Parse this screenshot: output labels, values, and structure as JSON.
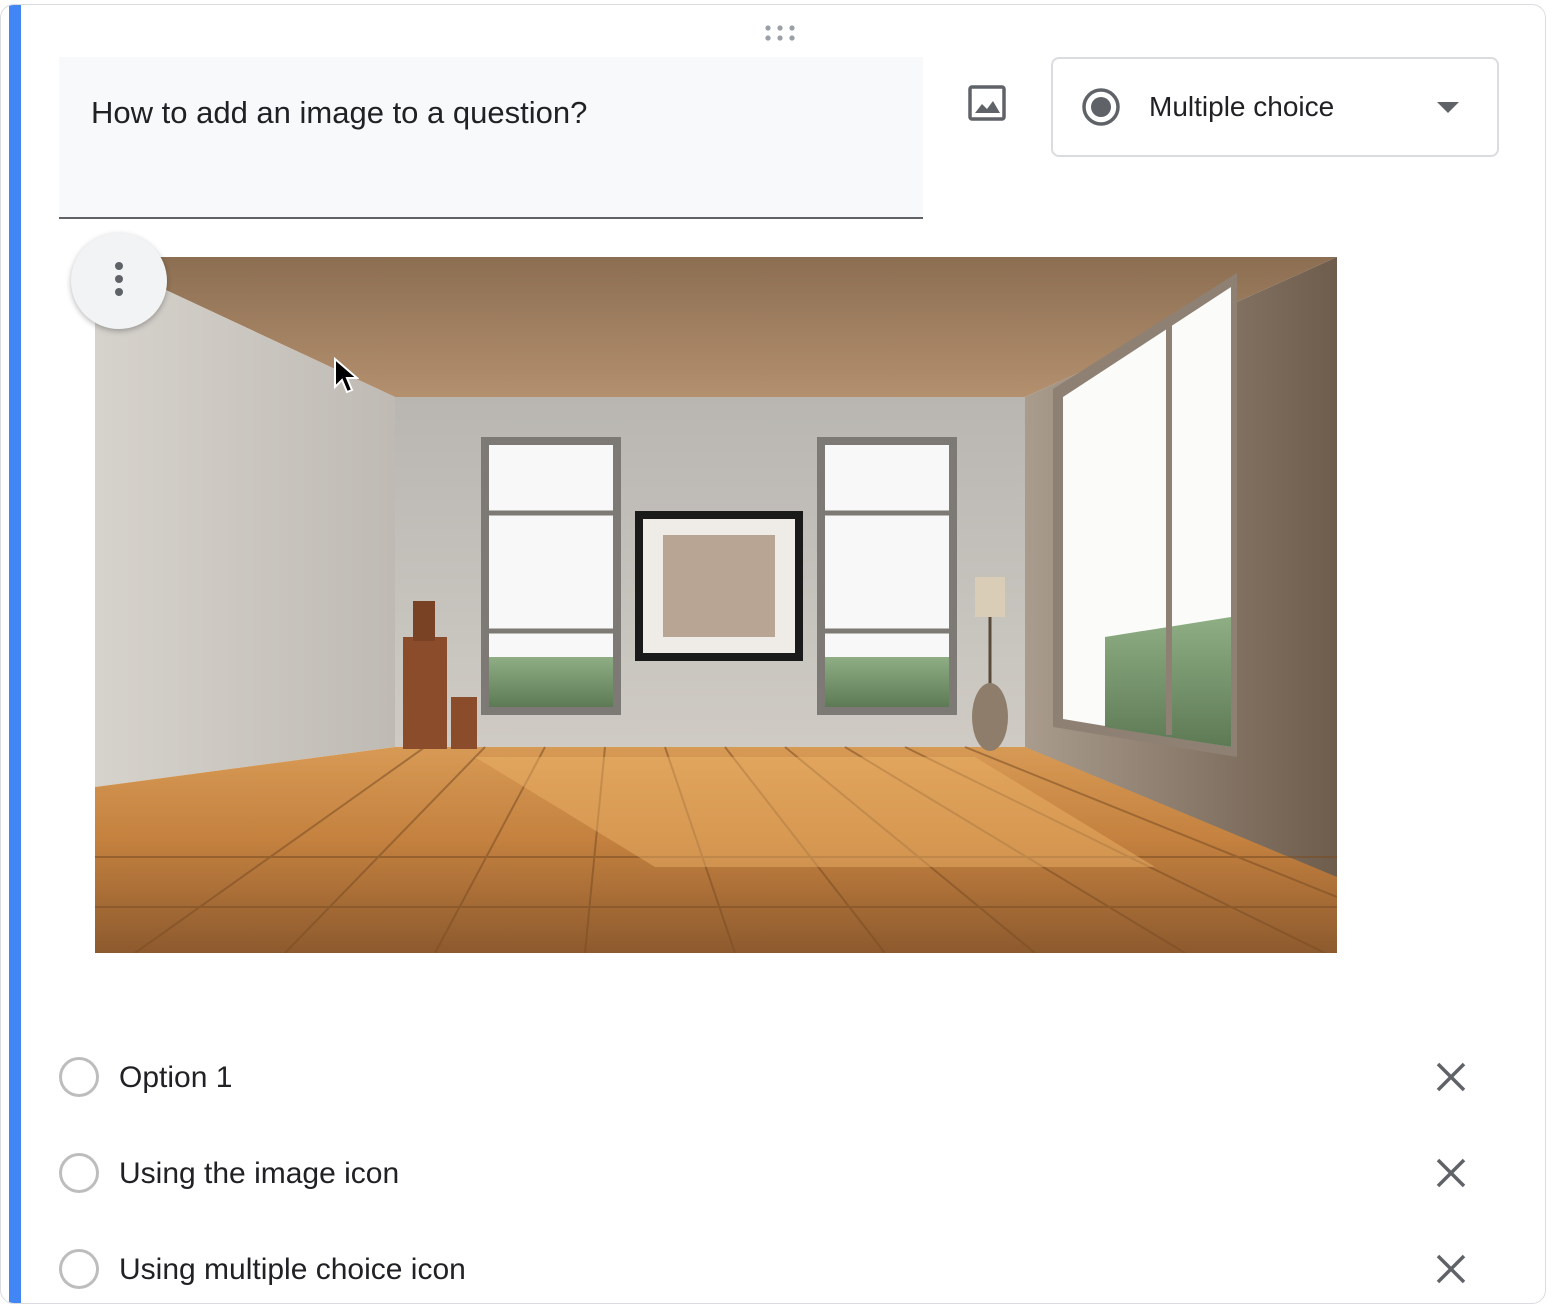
{
  "question": {
    "title": "How to add an image to a question?"
  },
  "toolbar": {
    "add_image_icon": "image-icon"
  },
  "question_type": {
    "selected": "Multiple choice",
    "icon": "radio-button-checked-icon"
  },
  "question_image": {
    "menu_icon": "more-vert-icon",
    "description_icon": "empty-room-photo"
  },
  "options": [
    {
      "label": "Option 1"
    },
    {
      "label": "Using the image icon"
    },
    {
      "label": "Using multiple choice icon"
    }
  ],
  "colors": {
    "accent": "#4285f4",
    "text": "#202124",
    "icon": "#5f6368"
  }
}
